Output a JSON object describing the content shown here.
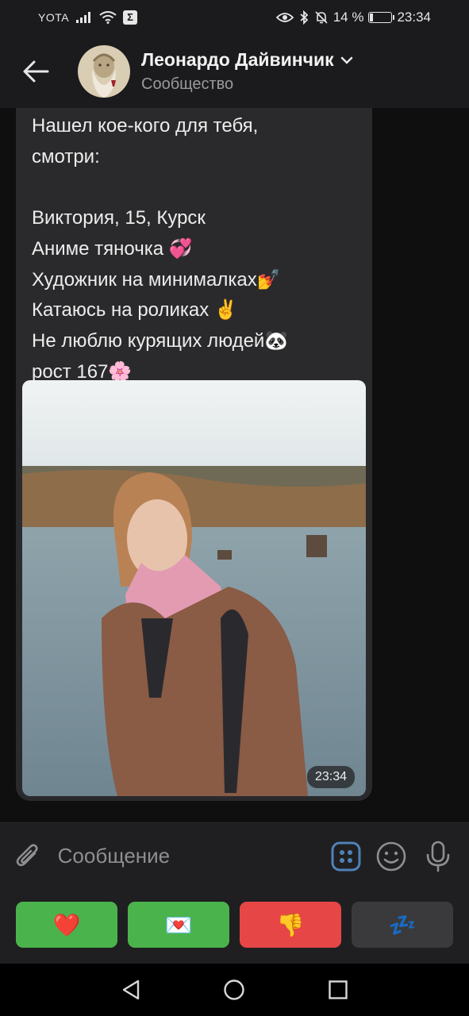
{
  "status_bar": {
    "carrier": "YOTA",
    "battery_text": "14 %",
    "battery_level": 0.14,
    "time": "23:34",
    "icons": [
      "signal-icon",
      "wifi-icon",
      "sigma-icon",
      "eye-icon",
      "bluetooth-icon",
      "mute-icon",
      "battery-icon"
    ]
  },
  "header": {
    "title": "Леонардо Дайвинчик",
    "subtitle": "Сообщество"
  },
  "message": {
    "text": "Нашел кое-кого для тебя,\nсмотри:\n\nВиктория, 15, Курск\nАниме тяночка 💞\nХудожник на минималках💅\nКатаюсь на роликах ✌️\nНе люблю курящих людей🐼\nрост 167🌸",
    "time": "23:34"
  },
  "composer": {
    "placeholder": "Сообщение"
  },
  "keyboard": {
    "buttons": [
      {
        "label": "❤️",
        "color": "#4bb34b"
      },
      {
        "label": "💌",
        "color": "#4bb34b"
      },
      {
        "label": "👎",
        "color": "#e64646"
      },
      {
        "label": "💤",
        "color": "#3a3a3c"
      }
    ]
  },
  "colors": {
    "accent": "#5181b8",
    "bubble": "#2a2a2c",
    "background": "#0f0f0f"
  }
}
